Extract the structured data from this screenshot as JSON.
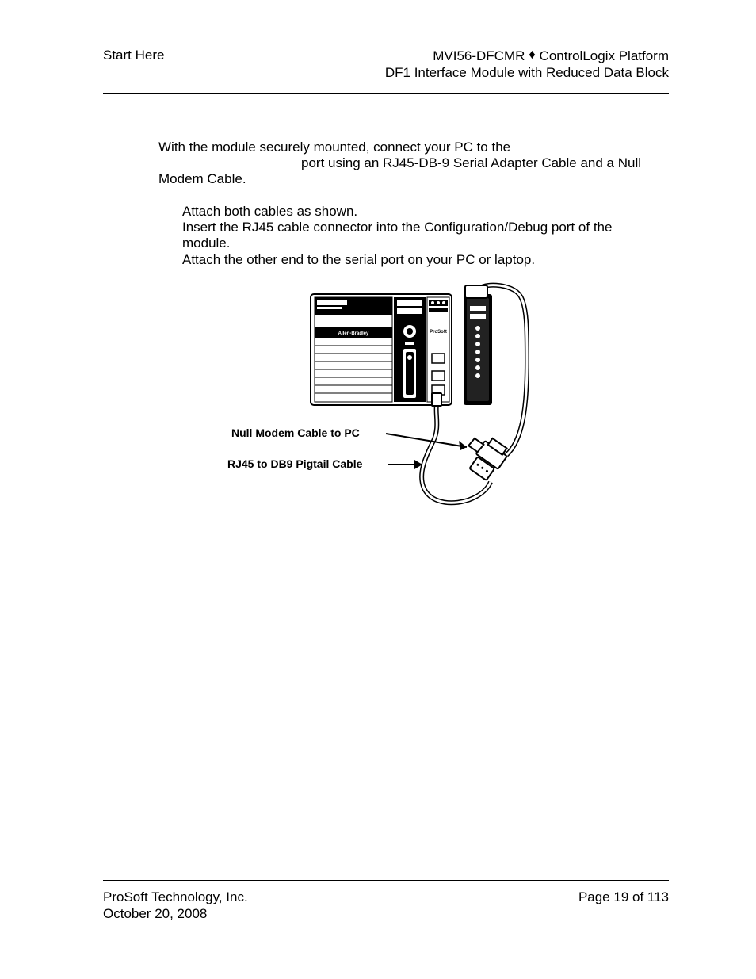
{
  "header": {
    "left": "Start Here",
    "right_line1_a": "MVI56-DFCMR ",
    "right_line1_b": " ControlLogix Platform",
    "right_line2": "DF1 Interface Module with Reduced Data Block",
    "diamond": "♦"
  },
  "body": {
    "line1": "With the module securely mounted, connect your PC to the",
    "line2": "port using an RJ45-DB-9 Serial Adapter Cable and a Null",
    "line3": "Modem Cable.",
    "step1": "Attach both cables as shown.",
    "step2a": "Insert the RJ45 cable connector into the Configuration/Debug port of the",
    "step2b": "module.",
    "step3": "Attach the other end to the serial port on your PC or laptop."
  },
  "diagram": {
    "label1": "Null Modem Cable to PC",
    "label2": "RJ45 to DB9 Pigtail Cable",
    "brand": "Allen-Bradley",
    "moduleBrand": "ProSoft"
  },
  "footer": {
    "company": "ProSoft Technology, Inc.",
    "date": "October 20, 2008",
    "page": "Page 19 of 113"
  }
}
